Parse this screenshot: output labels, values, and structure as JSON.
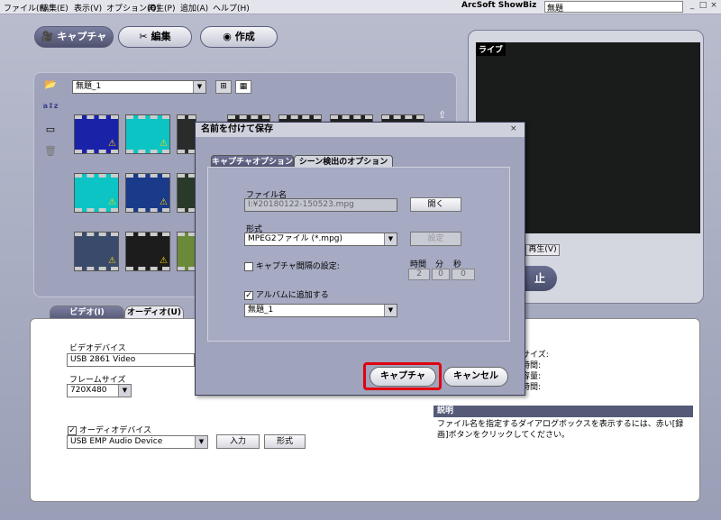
{
  "menu": [
    "ファイル(F)",
    "編集(E)",
    "表示(V)",
    "オプション(O)",
    "再生(P)",
    "追加(A)",
    "ヘルプ(H)"
  ],
  "app_title": "ArcSoft ShowBiz",
  "title_field": "無題",
  "window_buttons": [
    "_",
    "□",
    "×"
  ],
  "mode_tabs": [
    "キャプチャ",
    "編集",
    "作成"
  ],
  "album_select": "無題_1",
  "preview": {
    "label": "ライブ",
    "play_label": "再生(V)",
    "stop_label": "止"
  },
  "bottom_tabs": [
    "ビデオ(I)",
    "オーディオ(U)"
  ],
  "video": {
    "device_label": "ビデオデバイス",
    "device_value": "USB 2861 Video",
    "frame_size_label": "フレームサイズ",
    "frame_size_value": "720X480",
    "audio_device_label": "オーディオデバイス",
    "audio_device_value": "USB EMP Audio Device",
    "input_button": "入力",
    "format_button": "形式"
  },
  "right_info": [
    "サイズ:",
    "時間:",
    "容量:",
    "時間:"
  ],
  "description": {
    "header": "説明",
    "text": "ファイル名を指定するダイアログボックスを表示するには、赤い[録画]ボタンをクリックしてください。"
  },
  "dialog": {
    "title": "名前を付けて保存",
    "close": "×",
    "tabs": [
      "キャプチャオプション",
      "シーン検出のオプション"
    ],
    "filename_label": "ファイル名",
    "filename_value": "I:¥20180122-150523.mpg",
    "open_button": "開く",
    "format_label": "形式",
    "format_value": "MPEG2ファイル (*.mpg)",
    "settings_button": "設定",
    "interval_label": "キャプチャ間隔の設定:",
    "time_headers": [
      "時間",
      "分",
      "秒"
    ],
    "time_values": [
      "2",
      "0",
      "0"
    ],
    "add_album_label": "アルバムに追加する",
    "album_value": "無題_1",
    "capture_button": "キャプチャ",
    "cancel_button": "キャンセル"
  }
}
